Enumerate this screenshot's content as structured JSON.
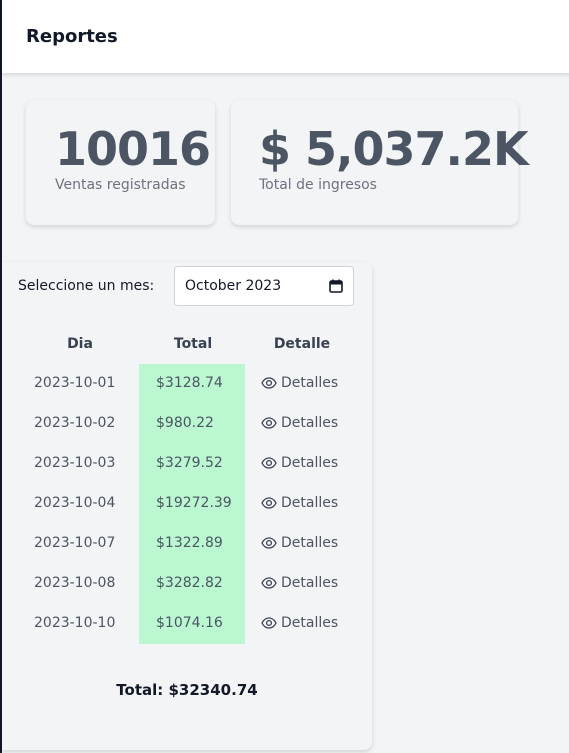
{
  "header": {
    "title": "Reportes"
  },
  "stats": [
    {
      "value": "10016",
      "label": "Ventas registradas"
    },
    {
      "value": "$ 5,037.2K",
      "label": "Total de ingresos"
    }
  ],
  "filter": {
    "label": "Seleccione un mes:",
    "value": "October 2023",
    "icon": "calendar-icon"
  },
  "table": {
    "columns": [
      "Dia",
      "Total",
      "Detalle"
    ],
    "rows": [
      {
        "dia": "2023-10-01",
        "total": "$3128.74",
        "detalle": "Detalles"
      },
      {
        "dia": "2023-10-02",
        "total": "$980.22",
        "detalle": "Detalles"
      },
      {
        "dia": "2023-10-03",
        "total": "$3279.52",
        "detalle": "Detalles"
      },
      {
        "dia": "2023-10-04",
        "total": "$19272.39",
        "detalle": "Detalles"
      },
      {
        "dia": "2023-10-07",
        "total": "$1322.89",
        "detalle": "Detalles"
      },
      {
        "dia": "2023-10-08",
        "total": "$3282.82",
        "detalle": "Detalles"
      },
      {
        "dia": "2023-10-10",
        "total": "$1074.16",
        "detalle": "Detalles"
      }
    ],
    "detail_icon": "eye-icon",
    "total_highlight_color": "#bbf7d0"
  },
  "summary": {
    "total": "Total: $32340.74"
  }
}
